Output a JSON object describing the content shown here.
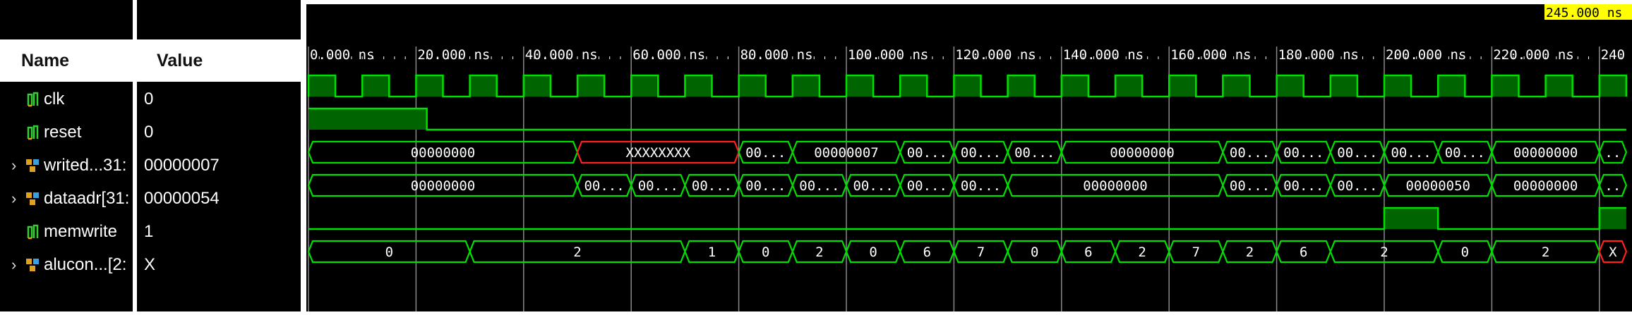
{
  "header": {
    "name_label": "Name",
    "value_label": "Value"
  },
  "cursor": {
    "label": "245.000 ns"
  },
  "timescale": {
    "ticks": [
      "0.000 ns",
      "20.000 ns",
      "40.000 ns",
      "60.000 ns",
      "80.000 ns",
      "100.000 ns",
      "120.000 ns",
      "140.000 ns",
      "160.000 ns",
      "180.000 ns",
      "200.000 ns",
      "220.000 ns",
      "240"
    ]
  },
  "signals": [
    {
      "name": "clk",
      "value": "0",
      "type": "bit",
      "expandable": false
    },
    {
      "name": "reset",
      "value": "0",
      "type": "bit",
      "expandable": false
    },
    {
      "name": "writed...31:",
      "value": "00000007",
      "type": "bus",
      "expandable": true
    },
    {
      "name": "dataadr[31:",
      "value": "00000054",
      "type": "bus",
      "expandable": true
    },
    {
      "name": "memwrite",
      "value": "1",
      "type": "bit",
      "expandable": false
    },
    {
      "name": "alucon...[2:",
      "value": "X",
      "type": "bus",
      "expandable": true
    }
  ],
  "waves": {
    "clk": {
      "period_ns": 10,
      "high_first_ns": 5
    },
    "reset": {
      "high_until_ns": 22
    },
    "writedata": [
      {
        "t0": 0,
        "t1": 50,
        "label": "00000000"
      },
      {
        "t0": 50,
        "t1": 80,
        "label": "XXXXXXXX",
        "state": "x"
      },
      {
        "t0": 80,
        "t1": 90,
        "label": "00..."
      },
      {
        "t0": 90,
        "t1": 110,
        "label": "00000007"
      },
      {
        "t0": 110,
        "t1": 120,
        "label": "00..."
      },
      {
        "t0": 120,
        "t1": 130,
        "label": "00..."
      },
      {
        "t0": 130,
        "t1": 140,
        "label": "00..."
      },
      {
        "t0": 140,
        "t1": 170,
        "label": "00000000"
      },
      {
        "t0": 170,
        "t1": 180,
        "label": "00..."
      },
      {
        "t0": 180,
        "t1": 190,
        "label": "00..."
      },
      {
        "t0": 190,
        "t1": 200,
        "label": "00..."
      },
      {
        "t0": 200,
        "t1": 210,
        "label": "00..."
      },
      {
        "t0": 210,
        "t1": 220,
        "label": "00..."
      },
      {
        "t0": 220,
        "t1": 240,
        "label": "00000000"
      },
      {
        "t0": 240,
        "t1": 245,
        "label": ".."
      }
    ],
    "dataadr": [
      {
        "t0": 0,
        "t1": 50,
        "label": "00000000"
      },
      {
        "t0": 50,
        "t1": 60,
        "label": "00..."
      },
      {
        "t0": 60,
        "t1": 70,
        "label": "00..."
      },
      {
        "t0": 70,
        "t1": 80,
        "label": "00..."
      },
      {
        "t0": 80,
        "t1": 90,
        "label": "00..."
      },
      {
        "t0": 90,
        "t1": 100,
        "label": "00..."
      },
      {
        "t0": 100,
        "t1": 110,
        "label": "00..."
      },
      {
        "t0": 110,
        "t1": 120,
        "label": "00..."
      },
      {
        "t0": 120,
        "t1": 130,
        "label": "00..."
      },
      {
        "t0": 130,
        "t1": 170,
        "label": "00000000"
      },
      {
        "t0": 170,
        "t1": 180,
        "label": "00..."
      },
      {
        "t0": 180,
        "t1": 190,
        "label": "00..."
      },
      {
        "t0": 190,
        "t1": 200,
        "label": "00..."
      },
      {
        "t0": 200,
        "t1": 220,
        "label": "00000050"
      },
      {
        "t0": 220,
        "t1": 240,
        "label": "00000000"
      },
      {
        "t0": 240,
        "t1": 245,
        "label": ".."
      }
    ],
    "memwrite": [
      {
        "t0": 0,
        "t1": 200,
        "v": 0
      },
      {
        "t0": 200,
        "t1": 210,
        "v": 1
      },
      {
        "t0": 210,
        "t1": 240,
        "v": 0
      },
      {
        "t0": 240,
        "t1": 245,
        "v": 1
      }
    ],
    "alucontrol": [
      {
        "t0": 0,
        "t1": 30,
        "label": "0"
      },
      {
        "t0": 30,
        "t1": 70,
        "label": "2"
      },
      {
        "t0": 70,
        "t1": 80,
        "label": "1"
      },
      {
        "t0": 80,
        "t1": 90,
        "label": "0"
      },
      {
        "t0": 90,
        "t1": 100,
        "label": "2"
      },
      {
        "t0": 100,
        "t1": 110,
        "label": "0"
      },
      {
        "t0": 110,
        "t1": 120,
        "label": "6"
      },
      {
        "t0": 120,
        "t1": 130,
        "label": "7"
      },
      {
        "t0": 130,
        "t1": 140,
        "label": "0"
      },
      {
        "t0": 140,
        "t1": 150,
        "label": "6"
      },
      {
        "t0": 150,
        "t1": 160,
        "label": "2"
      },
      {
        "t0": 160,
        "t1": 170,
        "label": "7"
      },
      {
        "t0": 170,
        "t1": 180,
        "label": "2"
      },
      {
        "t0": 180,
        "t1": 190,
        "label": "6"
      },
      {
        "t0": 190,
        "t1": 210,
        "label": "2"
      },
      {
        "t0": 210,
        "t1": 220,
        "label": "0"
      },
      {
        "t0": 220,
        "t1": 240,
        "label": "2"
      },
      {
        "t0": 240,
        "t1": 245,
        "label": "X",
        "state": "x"
      }
    ]
  },
  "colors": {
    "wave": "#00e000",
    "wave_fill": "#006400",
    "x_state": "#ff2020",
    "grid": "#8a8a8a",
    "cursor_bg": "#ffff00"
  }
}
